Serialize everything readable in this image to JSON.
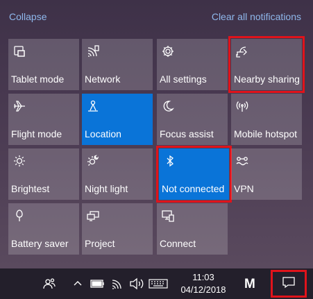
{
  "header": {
    "collapse_label": "Collapse",
    "clear_label": "Clear all notifications"
  },
  "tiles": [
    {
      "label": "Tablet mode",
      "icon": "tablet-mode-icon",
      "active": false
    },
    {
      "label": "Network",
      "icon": "network-icon",
      "active": false
    },
    {
      "label": "All settings",
      "icon": "gear-icon",
      "active": false
    },
    {
      "label": "Nearby sharing",
      "icon": "share-icon",
      "active": false,
      "highlighted": true
    },
    {
      "label": "Flight mode",
      "icon": "airplane-icon",
      "active": false
    },
    {
      "label": "Location",
      "icon": "location-icon",
      "active": true
    },
    {
      "label": "Focus assist",
      "icon": "moon-icon",
      "active": false
    },
    {
      "label": "Mobile hotspot",
      "icon": "hotspot-icon",
      "active": false
    },
    {
      "label": "Brightest",
      "icon": "sun-icon",
      "active": false
    },
    {
      "label": "Night light",
      "icon": "night-light-icon",
      "active": false
    },
    {
      "label": "Not connected",
      "icon": "bluetooth-icon",
      "active": true,
      "highlighted": true
    },
    {
      "label": "VPN",
      "icon": "vpn-icon",
      "active": false
    },
    {
      "label": "Battery saver",
      "icon": "battery-saver-icon",
      "active": false
    },
    {
      "label": "Project",
      "icon": "project-icon",
      "active": false
    },
    {
      "label": "Connect",
      "icon": "connect-icon",
      "active": false
    }
  ],
  "taskbar": {
    "time": "11:03",
    "date": "04/12/2018",
    "logo_text": "M",
    "icons": [
      "people-icon",
      "chevron-up-icon",
      "battery-icon",
      "wifi-icon",
      "volume-icon",
      "keyboard-icon",
      "action-center-icon"
    ]
  },
  "colors": {
    "accent": "#0a74d8",
    "highlight": "#e0131b",
    "link": "#8fb8ec",
    "taskbar": "#231f2b"
  }
}
